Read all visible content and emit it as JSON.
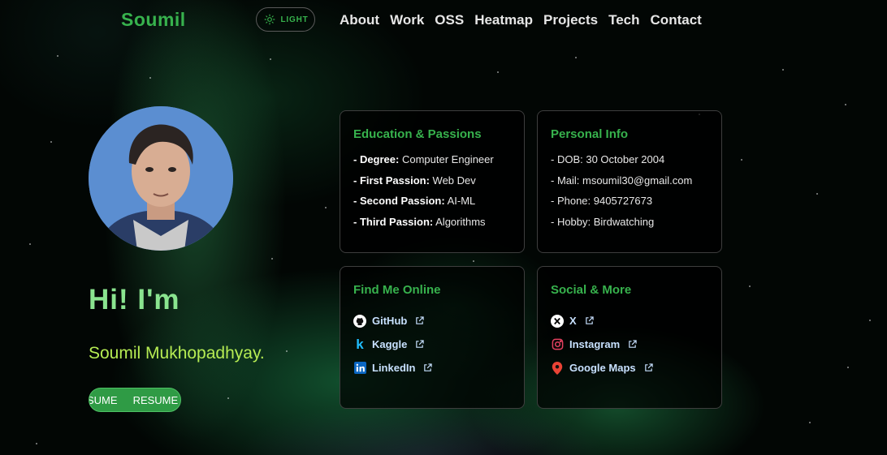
{
  "header": {
    "logo": "Soumil",
    "theme_toggle_label": "LIGHT",
    "nav_items": [
      "About",
      "Work",
      "OSS",
      "Heatmap",
      "Projects",
      "Tech",
      "Contact"
    ]
  },
  "hero": {
    "greeting": "Hi! I'm",
    "name": "Soumil Mukhopadhyay.",
    "resume_ghost_text": "SUME",
    "resume_label": "RESUME"
  },
  "education": {
    "title": "Education & Passions",
    "rows": [
      {
        "label": "- Degree:",
        "value": "Computer Engineer"
      },
      {
        "label": "- First Passion:",
        "value": "Web Dev"
      },
      {
        "label": "- Second Passion:",
        "value": "AI-ML"
      },
      {
        "label": "- Third Passion:",
        "value": "Algorithms"
      }
    ]
  },
  "personal": {
    "title": "Personal Info",
    "rows": [
      "- DOB: 30 October 2004",
      "- Mail: msoumil30@gmail.com",
      "- Phone: 9405727673",
      "- Hobby: Birdwatching"
    ]
  },
  "find_online": {
    "title": "Find Me Online",
    "links": [
      {
        "label": "GitHub",
        "icon": "github-icon"
      },
      {
        "label": "Kaggle",
        "icon": "kaggle-icon"
      },
      {
        "label": "LinkedIn",
        "icon": "linkedin-icon"
      }
    ]
  },
  "social": {
    "title": "Social & More",
    "links": [
      {
        "label": "X",
        "icon": "x-icon"
      },
      {
        "label": "Instagram",
        "icon": "instagram-icon"
      },
      {
        "label": "Google Maps",
        "icon": "map-pin-icon"
      }
    ]
  },
  "colors": {
    "accent_green": "#37b24d",
    "greeting_green": "#8ae48f",
    "name_lime": "#b6ec53",
    "button_green": "#2f9b45",
    "link_text": "#c8e1ff"
  }
}
